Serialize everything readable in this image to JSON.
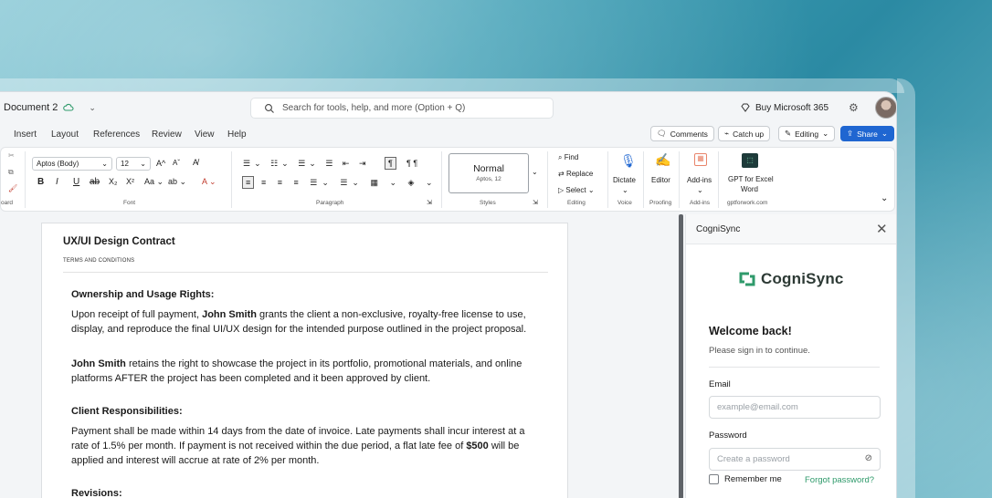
{
  "titlebar": {
    "doc_title": "Document 2",
    "search_placeholder": "Search for tools, help, and more (Option + Q)",
    "buy_label": "Buy Microsoft 365"
  },
  "menu": {
    "items": [
      "Insert",
      "Layout",
      "References",
      "Review",
      "View",
      "Help"
    ],
    "comments": "Comments",
    "catchup": "Catch up",
    "editing": "Editing",
    "share": "Share"
  },
  "ribbon": {
    "clipboard_label": "oard",
    "font_name": "Aptos (Body)",
    "font_size": "12",
    "font_group": "Font",
    "paragraph_group": "Paragraph",
    "style_name": "Normal",
    "style_sub": "Aptos, 12",
    "styles_group": "Styles",
    "find": "Find",
    "replace": "Replace",
    "select": "Select",
    "editing_group": "Editing",
    "dictate": "Dictate",
    "voice_group": "Voice",
    "editor": "Editor",
    "proofing_group": "Proofing",
    "addins": "Add-ins",
    "addins_group": "Add-ins",
    "gpt_line1": "GPT for Excel",
    "gpt_line2": "Word",
    "gpt_group": "gptforwork.com"
  },
  "document": {
    "title": "UX/UI Design Contract",
    "subtitle": "TERMS AND CONDITIONS",
    "sec1_heading": "Ownership and Usage Rights:",
    "sec1_p1_a": "Upon receipt of full payment, ",
    "sec1_p1_name": "John Smith",
    "sec1_p1_b": " grants the client a non-exclusive, royalty-free license to use, display, and reproduce the final UI/UX design for the intended purpose outlined in the project proposal.",
    "sec1_p2_name": "John Smith",
    "sec1_p2_b": " retains the right to showcase the project in its portfolio, promotional materials, and online platforms AFTER the project has been completed and it been approved by client.",
    "sec2_heading": "Client Responsibilities:",
    "sec2_p1_a": "Payment shall be made within 14 days from the date of invoice. Late payments shall incur interest at a rate of 1.5% per month. If payment is not received within the due period, a flat late fee of ",
    "sec2_p1_fee": "$500",
    "sec2_p1_b": " will be applied and interest will accrue at rate of 2% per month.",
    "sec3_heading": "Revisions:"
  },
  "pane": {
    "title": "CogniSync",
    "logo_text": "CogniSync",
    "welcome": "Welcome back!",
    "subtitle": "Please sign in to continue.",
    "email_label": "Email",
    "email_placeholder": "example@email.com",
    "password_label": "Password",
    "password_placeholder": "Create a password",
    "remember": "Remember me",
    "forgot": "Forgot password?"
  },
  "colors": {
    "accent": "#1f66d1",
    "brand_green": "#2f9a6b"
  }
}
